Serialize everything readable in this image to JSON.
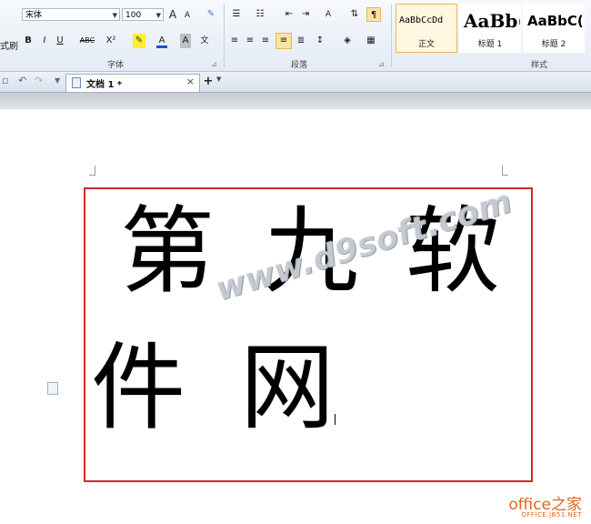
{
  "ribbon": {
    "left_cut_label": "式刷",
    "font": {
      "name_value": "宋体",
      "size_value": "100",
      "group_label": "字体",
      "buttons": [
        "B",
        "I",
        "U",
        "ABC",
        "X²",
        "A",
        "A"
      ],
      "grow_label": "A",
      "shrink_label": "A"
    },
    "paragraph": {
      "group_label": "段落"
    },
    "styles": {
      "group_label": "样式",
      "items": [
        {
          "sample": "AaBbCcDd",
          "name": "正文"
        },
        {
          "sample": "AaBb(",
          "name": "标题 1"
        },
        {
          "sample": "AaBbC(",
          "name": "标题 2"
        }
      ]
    }
  },
  "tabbar": {
    "doc_tab_label": "文档 1 *",
    "close_glyph": "×",
    "new_tab_glyph": "+"
  },
  "document": {
    "chars": [
      "第",
      "九",
      "软",
      "件",
      "网"
    ]
  },
  "watermark": "www.d9soft.com",
  "logo": {
    "main": "office之家",
    "sub": "OFFICE.JB51.NET"
  }
}
